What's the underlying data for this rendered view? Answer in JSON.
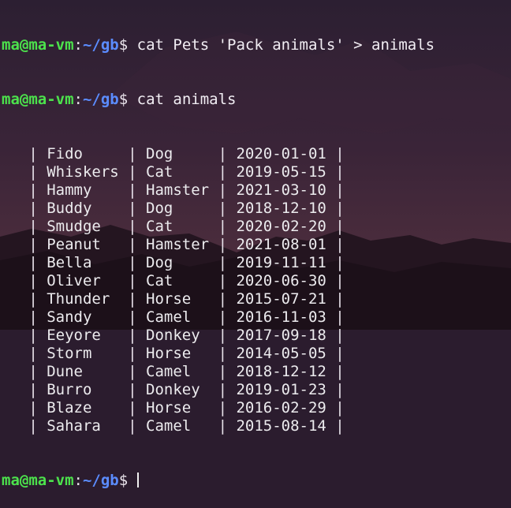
{
  "prompt": {
    "user": "ma@ma-vm",
    "colon": ":",
    "path": "~/gb",
    "dollar": "$ "
  },
  "commands": [
    "cat Pets 'Pack animals' > animals",
    "cat animals"
  ],
  "table": {
    "rows": [
      [
        "Fido",
        "Dog",
        "2020-01-01"
      ],
      [
        "Whiskers",
        "Cat",
        "2019-05-15"
      ],
      [
        "Hammy",
        "Hamster",
        "2021-03-10"
      ],
      [
        "Buddy",
        "Dog",
        "2018-12-10"
      ],
      [
        "Smudge",
        "Cat",
        "2020-02-20"
      ],
      [
        "Peanut",
        "Hamster",
        "2021-08-01"
      ],
      [
        "Bella",
        "Dog",
        "2019-11-11"
      ],
      [
        "Oliver",
        "Cat",
        "2020-06-30"
      ],
      [
        "Thunder",
        "Horse",
        "2015-07-21"
      ],
      [
        "Sandy",
        "Camel",
        "2016-11-03"
      ],
      [
        "Eeyore",
        "Donkey",
        "2017-09-18"
      ],
      [
        "Storm",
        "Horse",
        "2014-05-05"
      ],
      [
        "Dune",
        "Camel",
        "2018-12-12"
      ],
      [
        "Burro",
        "Donkey",
        "2019-01-23"
      ],
      [
        "Blaze",
        "Horse",
        "2016-02-29"
      ],
      [
        "Sahara",
        "Camel",
        "2015-08-14"
      ]
    ]
  },
  "colors": {
    "user": "#4ce24c",
    "path": "#5b8cff",
    "text": "#e8e2ea"
  }
}
